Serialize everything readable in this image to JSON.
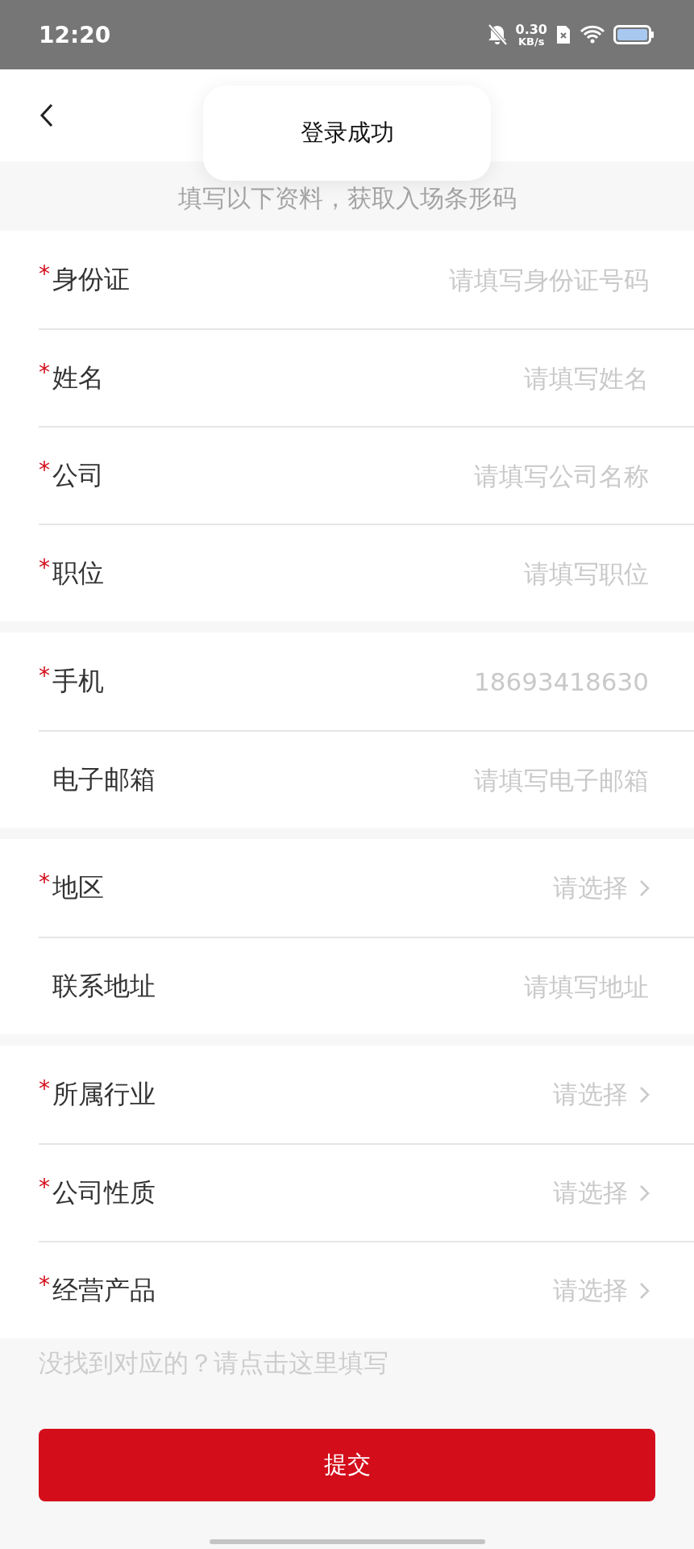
{
  "status_bar": {
    "time": "12:20",
    "speed": "0.30",
    "speed_unit": "KB/s"
  },
  "toast": "登录成功",
  "required_mark": "*",
  "subtitle": "填写以下资料，获取入场条形码",
  "groups": [
    {
      "rows": [
        {
          "kind": "input",
          "label": "身份证",
          "required": true,
          "placeholder": "请填写身份证号码"
        },
        {
          "kind": "input",
          "label": "姓名",
          "required": true,
          "placeholder": "请填写姓名"
        },
        {
          "kind": "input",
          "label": "公司",
          "required": true,
          "placeholder": "请填写公司名称"
        },
        {
          "kind": "input",
          "label": "职位",
          "required": true,
          "placeholder": "请填写职位"
        }
      ]
    },
    {
      "rows": [
        {
          "kind": "input",
          "label": "手机",
          "required": true,
          "value": "18693418630"
        },
        {
          "kind": "input",
          "label": "电子邮箱",
          "required": false,
          "placeholder": "请填写电子邮箱"
        }
      ]
    },
    {
      "rows": [
        {
          "kind": "select",
          "label": "地区",
          "required": true,
          "placeholder": "请选择"
        },
        {
          "kind": "input",
          "label": "联系地址",
          "required": false,
          "placeholder": "请填写地址"
        }
      ]
    },
    {
      "rows": [
        {
          "kind": "select",
          "label": "所属行业",
          "required": true,
          "placeholder": "请选择"
        },
        {
          "kind": "select",
          "label": "公司性质",
          "required": true,
          "placeholder": "请选择"
        },
        {
          "kind": "select",
          "label": "经营产品",
          "required": true,
          "placeholder": "请选择"
        }
      ]
    }
  ],
  "hint_link": "没找到对应的？请点击这里填写",
  "submit": "提交"
}
